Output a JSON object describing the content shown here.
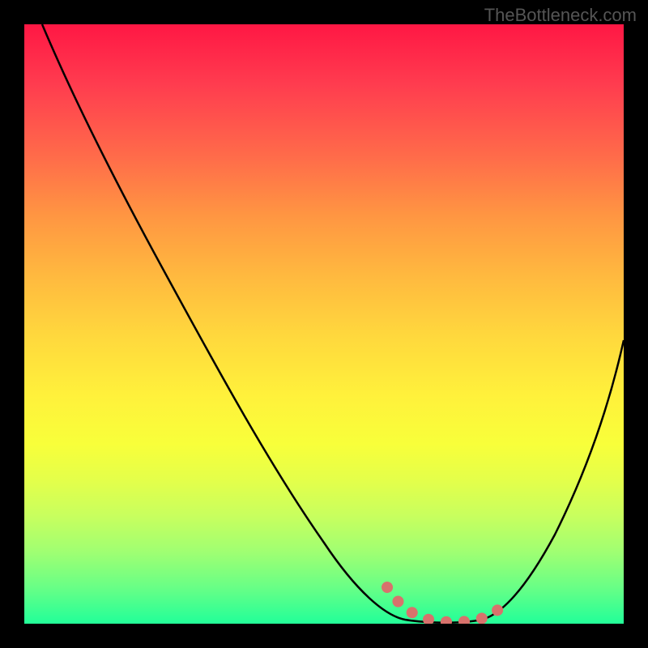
{
  "watermark": "TheBottleneck.com",
  "chart_data": {
    "type": "line",
    "title": "",
    "xlabel": "",
    "ylabel": "",
    "xlim": [
      0,
      100
    ],
    "ylim": [
      0,
      100
    ],
    "series": [
      {
        "name": "curve",
        "x": [
          3,
          10,
          20,
          30,
          40,
          50,
          55,
          60,
          62,
          65,
          70,
          75,
          80,
          85,
          90,
          95,
          100
        ],
        "y": [
          100,
          87,
          73,
          59,
          44,
          30,
          20,
          10,
          5,
          2,
          0,
          0,
          2,
          8,
          18,
          32,
          48
        ]
      },
      {
        "name": "highlight-dots",
        "x": [
          60,
          63,
          66,
          69,
          72,
          75,
          77,
          79
        ],
        "y": [
          7,
          2,
          0,
          0,
          0,
          0,
          1,
          3
        ]
      }
    ],
    "gradient": {
      "top": "#ff1744",
      "middle": "#ffe83b",
      "bottom": "#24ff98"
    }
  }
}
